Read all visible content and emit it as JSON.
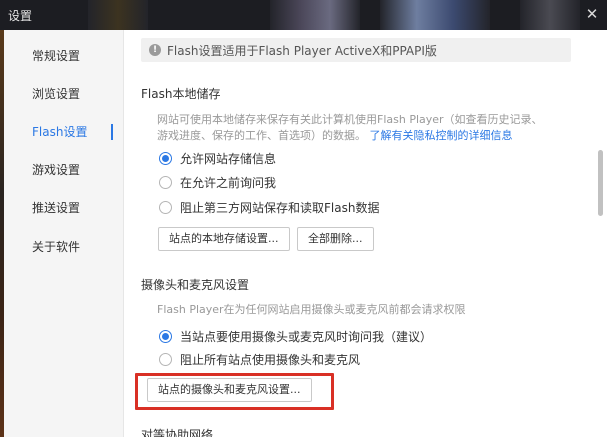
{
  "window": {
    "title": "设置"
  },
  "sidebar": {
    "items": [
      {
        "label": "常规设置",
        "active": false
      },
      {
        "label": "浏览设置",
        "active": false
      },
      {
        "label": "Flash设置",
        "active": true
      },
      {
        "label": "游戏设置",
        "active": false
      },
      {
        "label": "推送设置",
        "active": false
      },
      {
        "label": "关于软件",
        "active": false
      }
    ]
  },
  "content": {
    "notice": "Flash设置适用于Flash Player ActiveX和PPAPI版",
    "storage": {
      "title": "Flash本地储存",
      "desc_line1": "网站可使用本地储存来保存有关此计算机使用Flash Player（如查看历史记录、",
      "desc_line2": "游戏进度、保存的工作、首选项）的数据。",
      "link": "了解有关隐私控制的详细信息",
      "options": [
        {
          "label": "允许网站存储信息",
          "checked": true
        },
        {
          "label": "在允许之前询问我",
          "checked": false
        },
        {
          "label": "阻止第三方网站保存和读取Flash数据",
          "checked": false
        }
      ],
      "btn_site_settings": "站点的本地存储设置...",
      "btn_delete_all": "全部删除..."
    },
    "camera": {
      "title": "摄像头和麦克风设置",
      "desc": "Flash Player在为任何网站启用摄像头或麦克风前都会请求权限",
      "options": [
        {
          "label": "当站点要使用摄像头或麦克风时询问我（建议）",
          "checked": true
        },
        {
          "label": "阻止所有站点使用摄像头和麦克风",
          "checked": false
        }
      ],
      "btn_site_settings": "站点的摄像头和麦克风设置..."
    },
    "next_section_title": "对等协助网络"
  },
  "colors": {
    "accent": "#2b78e4",
    "highlight": "#d93025",
    "titlebar": "#1c1d22"
  }
}
